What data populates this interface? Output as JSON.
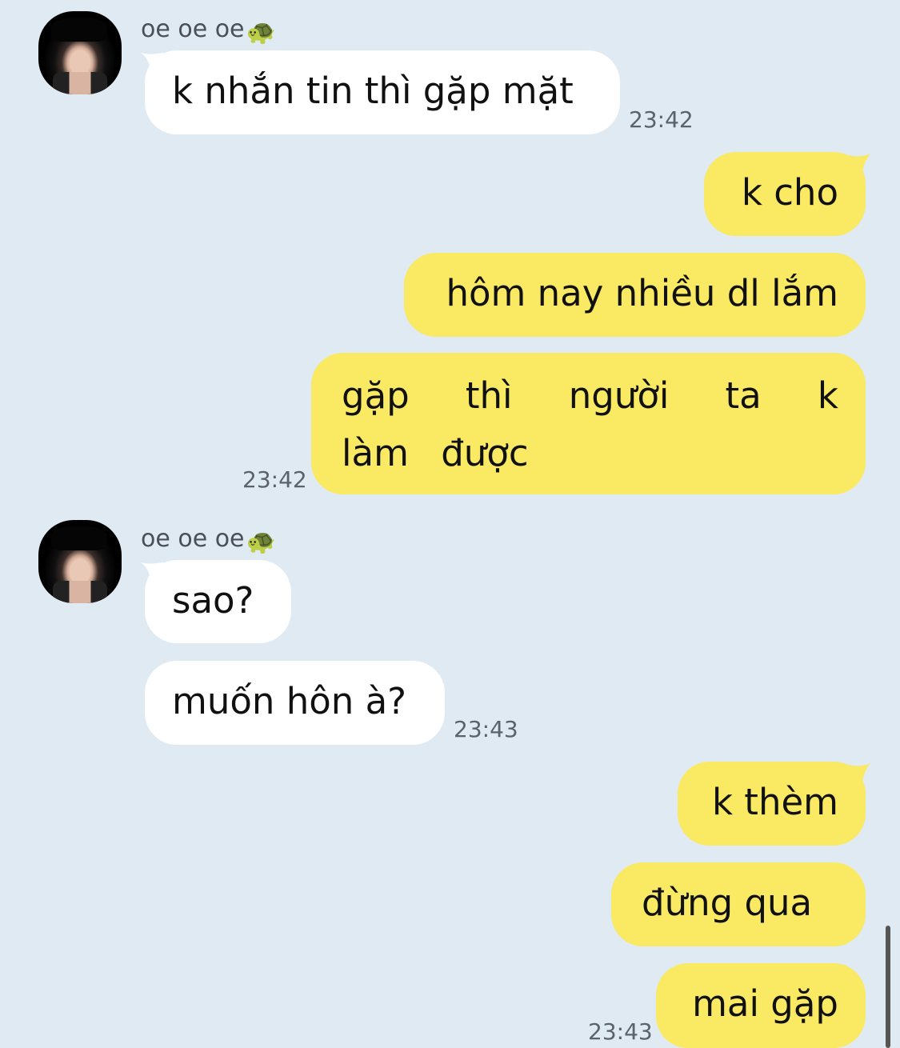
{
  "chat": {
    "contact": {
      "name": "oe oe oe",
      "emoji": "🐢"
    },
    "messages": [
      {
        "id": "m1",
        "direction": "in",
        "text": "k nhắn tin thì gặp mặt",
        "time": "23:42"
      },
      {
        "id": "m2",
        "direction": "out",
        "text": "k cho"
      },
      {
        "id": "m3",
        "direction": "out",
        "text": "hôm nay nhiều dl lắm"
      },
      {
        "id": "m4",
        "direction": "out",
        "text": "gặp thì người ta k làm được",
        "time": "23:42"
      },
      {
        "id": "m5",
        "direction": "in",
        "text": "sao?"
      },
      {
        "id": "m6",
        "direction": "in",
        "text": "muốn hôn à?",
        "time": "23:43"
      },
      {
        "id": "m7",
        "direction": "out",
        "text": "k thèm"
      },
      {
        "id": "m8",
        "direction": "out",
        "text": "đừng qua"
      },
      {
        "id": "m9",
        "direction": "out",
        "text": "mai gặp",
        "time": "23:43"
      }
    ]
  },
  "colors": {
    "background": "#dfeaf3",
    "incoming_bubble": "#ffffff",
    "outgoing_bubble": "#f9e963",
    "timestamp": "#5b626b"
  }
}
